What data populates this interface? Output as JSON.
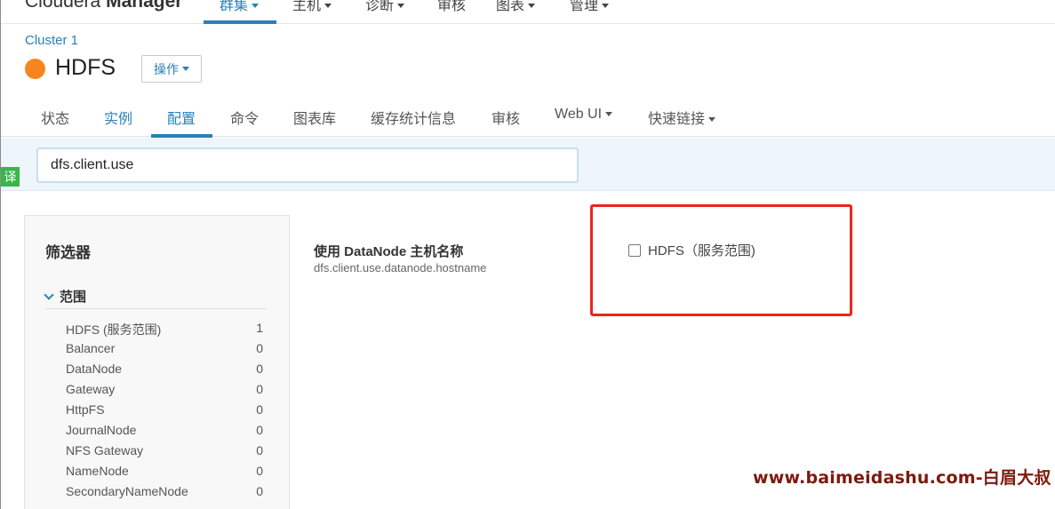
{
  "app": {
    "brand_light": "Cloudera",
    "brand_bold": "Manager"
  },
  "topnav": {
    "items": [
      {
        "label": "群集",
        "active": true,
        "has_caret": true
      },
      {
        "label": "主机",
        "has_caret": true
      },
      {
        "label": "诊断",
        "has_caret": true
      },
      {
        "label": "审核",
        "has_caret": false
      },
      {
        "label": "图表",
        "has_caret": true
      },
      {
        "label": "管理",
        "has_caret": true
      }
    ]
  },
  "header": {
    "cluster": "Cluster 1",
    "service": "HDFS",
    "status_color": "#f7851e",
    "actions_label": "操作"
  },
  "tabs": [
    {
      "label": "状态"
    },
    {
      "label": "实例"
    },
    {
      "label": "配置",
      "active": true
    },
    {
      "label": "命令"
    },
    {
      "label": "图表库"
    },
    {
      "label": "缓存统计信息"
    },
    {
      "label": "审核"
    },
    {
      "label": "Web UI"
    },
    {
      "label": "快速链接"
    }
  ],
  "search": {
    "value": "dfs.client.use",
    "translate_label": "译"
  },
  "filters": {
    "title": "筛选器",
    "scope_title": "范围",
    "scope_items": [
      {
        "label": "HDFS (服务范围)",
        "count": "1"
      },
      {
        "label": "Balancer",
        "count": "0"
      },
      {
        "label": "DataNode",
        "count": "0"
      },
      {
        "label": "Gateway",
        "count": "0"
      },
      {
        "label": "HttpFS",
        "count": "0"
      },
      {
        "label": "JournalNode",
        "count": "0"
      },
      {
        "label": "NFS Gateway",
        "count": "0"
      },
      {
        "label": "NameNode",
        "count": "0"
      },
      {
        "label": "SecondaryNameNode",
        "count": "0"
      }
    ]
  },
  "property": {
    "display_name": "使用 DataNode 主机名称",
    "key": "dfs.client.use.datanode.hostname",
    "value_label": "HDFS（服务范围)",
    "checked": false
  },
  "accent_color": "#2a80b9",
  "highlight_color": "#e8261e",
  "watermark": "www.baimeidashu.com-白眉大叔"
}
